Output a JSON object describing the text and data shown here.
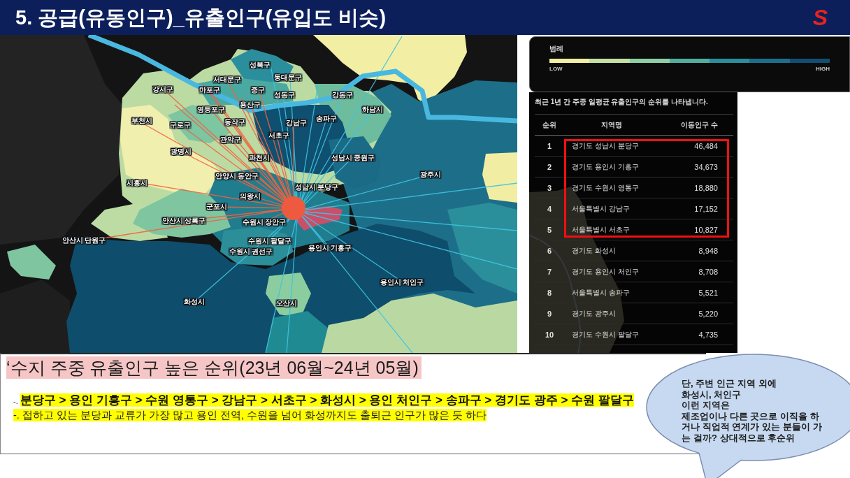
{
  "header": {
    "title": "5. 공급(유동인구)_유출인구(유입도 비슷)",
    "logo_text": "S"
  },
  "map": {
    "region_labels": [
      "성북구",
      "서대문구",
      "동대문구",
      "강서구",
      "마포구",
      "중구",
      "성동구",
      "강동구",
      "용산구",
      "영등포구",
      "하남시",
      "부천시",
      "구로구",
      "동작구",
      "강남구",
      "송파구",
      "서초구",
      "관악구",
      "광명시",
      "과천시",
      "성남시 중원구",
      "안양시 동안구",
      "광주시",
      "시흥시",
      "성남시 분당구",
      "의왕시",
      "군포시",
      "안산시 상록구",
      "수원시 장안구",
      "안산시 단원구",
      "수원시 팔달구",
      "수원시 권선구",
      "용인시 기흥구",
      "용인시 처인구",
      "화성시",
      "오산시"
    ]
  },
  "legend": {
    "title": "범례",
    "low_label": "LOW",
    "high_label": "HIGH",
    "steps": [
      {
        "color": "#f2eea3"
      },
      {
        "color": "#c4e0a7"
      },
      {
        "color": "#8ecea3"
      },
      {
        "color": "#52ae9f"
      },
      {
        "color": "#2a8f9c"
      },
      {
        "color": "#1c6f8c"
      },
      {
        "color": "#114f72"
      }
    ]
  },
  "ranking_table": {
    "caption": "최근 1년 간 주중 일평균 유출인구의 순위를 나타냅니다.",
    "columns": [
      "순위",
      "지역명",
      "이동인구 수"
    ],
    "rows": [
      {
        "rank": "1",
        "region": "경기도 성남시 분당구",
        "count": "46,484",
        "highlighted": true
      },
      {
        "rank": "2",
        "region": "경기도 용인시 기흥구",
        "count": "34,673",
        "highlighted": true
      },
      {
        "rank": "3",
        "region": "경기도 수원시 영통구",
        "count": "18,880",
        "highlighted": true
      },
      {
        "rank": "4",
        "region": "서울특별시 강남구",
        "count": "17,152",
        "highlighted": true
      },
      {
        "rank": "5",
        "region": "서울특별시 서초구",
        "count": "10,827",
        "highlighted": true
      },
      {
        "rank": "6",
        "region": "경기도 화성시",
        "count": "8,948",
        "highlighted": false
      },
      {
        "rank": "7",
        "region": "경기도 용인시 처인구",
        "count": "8,708",
        "highlighted": false
      },
      {
        "rank": "8",
        "region": "서울특별시 송파구",
        "count": "5,521",
        "highlighted": false
      },
      {
        "rank": "9",
        "region": "경기도 광주시",
        "count": "5,220",
        "highlighted": false
      },
      {
        "rank": "10",
        "region": "경기도 수원시 팔달구",
        "count": "4,735",
        "highlighted": false
      }
    ]
  },
  "summary": {
    "title": "‘수지 주중 유출인구 높은 순위(23년 06월~24년 05월)",
    "ranking_line": "-. **분당구 > 용인 기흥구 > 수원 영통구 > 강남구 > 서초구 > 화성시 > 용인 처인구 > 송파구 > 경기도 광주 > 수원 팔달구**",
    "note_line": "-. 접하고 있는 분당과 교류가 가장 많고 용인 전역, 수원을 넘어 화성까지도 출퇴근 인구가 많은 듯 하다"
  },
  "speech_bubble": {
    "text": "단, 주변 인근 지역 외에\n화성시, 처인구\n이런 지역은\n제조업이나 다른 곳으로 이직을 하\n거나 직업적 연계가 있는 분들이 가\n는 걸까? 상대적으로 후순위"
  }
}
